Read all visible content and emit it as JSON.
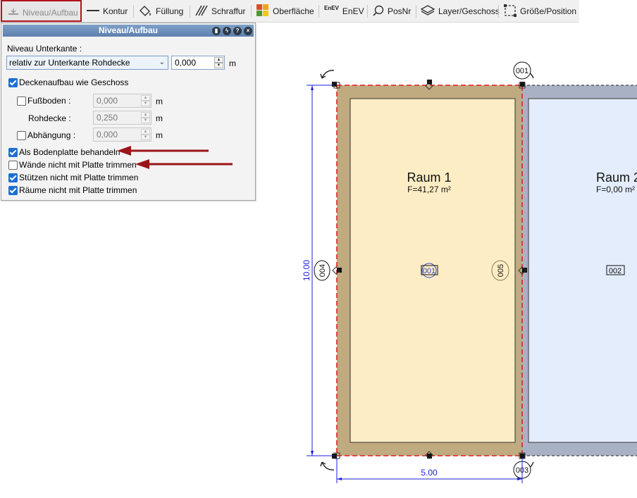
{
  "toolbar": {
    "items": [
      {
        "label": "Niveau/Aufbau",
        "icon": "level-icon"
      },
      {
        "label": "Kontur",
        "icon": "line-icon"
      },
      {
        "label": "Füllung",
        "icon": "fill-bucket-icon"
      },
      {
        "label": "Schraffur",
        "icon": "hatch-icon"
      },
      {
        "label": "Oberfläche",
        "icon": "surface-icon"
      },
      {
        "label": "EnEV",
        "icon": "enev-icon"
      },
      {
        "label": "PosNr",
        "icon": "posnr-icon"
      },
      {
        "label": "Layer/Geschoss",
        "icon": "layers-icon"
      },
      {
        "label": "Größe/Position",
        "icon": "size-position-icon"
      }
    ],
    "enev_small": "EnEV"
  },
  "panel": {
    "title": "Niveau/Aufbau",
    "niveau_label": "Niveau Unterkante :",
    "niveau_select": "relativ zur Unterkante Rohdecke",
    "niveau_value": "0,000",
    "unit": "m",
    "deckenaufbau_label": "Deckenaufbau wie Geschoss",
    "fussboden_label": "Fußboden :",
    "fussboden_value": "0,000",
    "rohdecke_label": "Rohdecke :",
    "rohdecke_value": "0,250",
    "abhaengung_label": "Abhängung :",
    "abhaengung_value": "0,000",
    "bodenplatte_label": "Als Bodenplatte behandeln",
    "waende_label": "Wände nicht mit Platte trimmen",
    "stuetzen_label": "Stützen nicht mit Platte trimmen",
    "raeume_label": "Räume nicht mit Platte trimmen",
    "checks": {
      "deckenaufbau": true,
      "fussboden": false,
      "abhaengung": false,
      "bodenplatte": true,
      "waende": false,
      "stuetzen": true,
      "raeume": true
    }
  },
  "drawing": {
    "room1_name": "Raum 1",
    "room1_area": "F=41,27 m²",
    "room1_id": "001",
    "room2_name": "Raum 2",
    "room2_area": "F=0,00 m²",
    "room2_id": "002",
    "wall_004": "004",
    "wall_005": "005",
    "wall_001": "001",
    "wall_003": "003",
    "dim_vertical": "10.00",
    "dim_horizontal": "5.00"
  },
  "colors": {
    "accent_red": "#b5121b",
    "arrow_red": "#9b1418",
    "room1_fill": "#fdedc4",
    "room1_wall": "#c0aa80",
    "room2_fill": "#e4edfb",
    "room2_wall": "#a9b2c4",
    "dimension_blue": "#1e1ee0"
  }
}
